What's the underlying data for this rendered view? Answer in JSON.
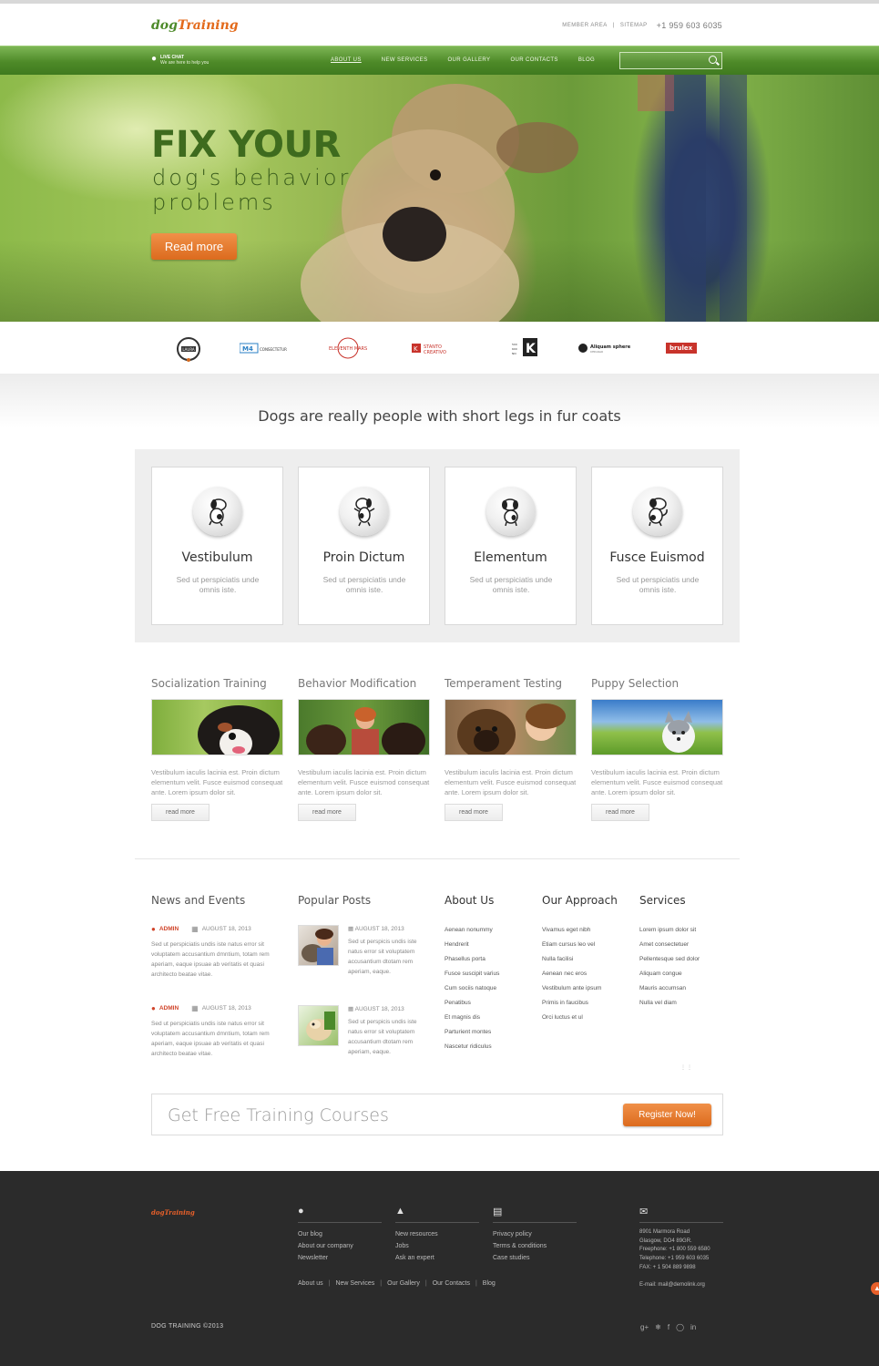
{
  "header": {
    "logo_part1": "dog",
    "logo_part2": "Training",
    "member_area": "MEMBER AREA",
    "sitemap": "SITEMAP",
    "phone": "+1 959 603 6035"
  },
  "navbar": {
    "livechat_title": "LIVE CHAT",
    "livechat_sub": "We are here to help you",
    "menu": [
      "ABOUT US",
      "NEW SERVICES",
      "OUR GALLERY",
      "OUR CONTACTS",
      "BLOG"
    ],
    "search_placeholder": ""
  },
  "hero": {
    "title": "FIX YOUR",
    "subtitle_line1": "dog's behavior",
    "subtitle_line2": "problems",
    "button": "Read more"
  },
  "partners": [
    "LAURA",
    "M4 CONSECTETUR",
    "ELEVENTH MARS",
    "STANTO CREATIVO",
    "K",
    "Aliquam sphere",
    "brulex"
  ],
  "tagline": "Dogs are really people with short legs in fur coats",
  "features": [
    {
      "title": "Vestibulum",
      "text": "Sed ut perspiciatis unde omnis iste."
    },
    {
      "title": "Proin Dictum",
      "text": "Sed ut perspiciatis unde omnis iste."
    },
    {
      "title": "Elementum",
      "text": "Sed ut perspiciatis unde omnis iste."
    },
    {
      "title": "Fusce Euismod",
      "text": "Sed ut perspiciatis unde omnis iste."
    }
  ],
  "services": [
    {
      "title": "Socialization Training",
      "text": "Vestibulum iaculis lacinia est. Proin dictum elementum velit. Fusce euismod consequat ante. Lorem ipsum dolor sit.",
      "button": "read more"
    },
    {
      "title": "Behavior Modification",
      "text": "Vestibulum iaculis lacinia est. Proin dictum elementum velit. Fusce euismod consequat ante. Lorem ipsum dolor sit.",
      "button": "read more"
    },
    {
      "title": "Temperament Testing",
      "text": "Vestibulum iaculis lacinia est. Proin dictum elementum velit. Fusce euismod consequat ante. Lorem ipsum dolor sit.",
      "button": "read more"
    },
    {
      "title": "Puppy Selection",
      "text": "Vestibulum iaculis lacinia est. Proin dictum elementum velit. Fusce euismod consequat ante. Lorem ipsum dolor sit.",
      "button": "read more"
    }
  ],
  "news": {
    "heading": "News and Events",
    "items": [
      {
        "author": "ADMIN",
        "date": "AUGUST 18, 2013",
        "text": "Sed ut perspiciatis undis iste natus error sit voluptatem accusantium dmntium, totam rem aperiam, eaque ipsuae ab veritatis et quasi architecto beatae vitae."
      },
      {
        "author": "ADMIN",
        "date": "AUGUST 18, 2013",
        "text": "Sed ut perspiciatis undis iste natus error sit voluptatem accusantium dmntium, totam rem aperiam, eaque ipsuae ab veritatis et quasi architecto beatae vitae."
      }
    ]
  },
  "popular": {
    "heading": "Popular Posts",
    "items": [
      {
        "date": "AUGUST 18, 2013",
        "text": "Sed ut perspicis undis iste natus error sit voluptatem accusantium dtotam rem aperiam, eaque."
      },
      {
        "date": "AUGUST 18, 2013",
        "text": "Sed ut perspicis undis iste natus error sit voluptatem accusantium dtotam rem aperiam, eaque."
      }
    ]
  },
  "about": {
    "heading": "About Us",
    "links": [
      "Aenean nonummy",
      "Hendrerit",
      "Phasellus porta",
      "Fusce suscipit varius",
      "Cum sociis natoque",
      "Penatibus",
      "Et magnis dis",
      "Parturient montes",
      "Nascetur ridiculus"
    ]
  },
  "approach": {
    "heading": "Our Approach",
    "links": [
      "Vivamus eget nibh",
      "Etiam cursus leo vel",
      "Nulla facilisi",
      "Aenean nec eros",
      "Vestibulum ante ipsum",
      "Primis in faucibus",
      "Orci luctus et ul"
    ]
  },
  "services_links": {
    "heading": "Services",
    "links": [
      "Lorem ipsum dolor sit",
      "Amet consectetuer",
      "Pellentesque sed dolor",
      "Aliquam congue",
      "Mauris accumsan",
      "Nulla vel diam"
    ]
  },
  "cta": {
    "text": "Get Free Training Courses",
    "button": "Register Now!"
  },
  "footer": {
    "logo": "dogTraining",
    "col1": [
      "Our blog",
      "About our company",
      "Newsletter"
    ],
    "col2": [
      "New resources",
      "Jobs",
      "Ask an expert"
    ],
    "col3": [
      "Privacy policy",
      "Terms & conditions",
      "Case studies"
    ],
    "nav": [
      "About us",
      "New Services",
      "Our Gallery",
      "Our Contacts",
      "Blog"
    ],
    "address": [
      "8901 Marmora Road",
      "Glasgow, DO4 89GR.",
      "Freephone:   +1 800 559 6580",
      "Telephone:    +1 959 603 6035",
      "FAX:              + 1 504 889 9898"
    ],
    "email": "E-mail: mail@demolink.org",
    "copyright": "DOG TRAINING ©2013",
    "social": [
      "g+",
      "twitter",
      "f",
      "pinterest",
      "in"
    ]
  },
  "colors": {
    "green": "#4e8a2a",
    "orange": "#e36a1b",
    "footer_bg": "#2b2b2b"
  }
}
